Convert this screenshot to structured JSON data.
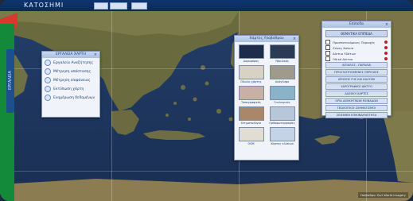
{
  "app": {
    "title": "ΚΑΤΟΣΗΜΙ"
  },
  "sidebar_tab": {
    "label": "ΕΡΓΑΛΕΙΑ"
  },
  "left_panel": {
    "title": "ΕΡΓΑΛΕΙΑ ΧΑΡΤΗ",
    "items": [
      {
        "label": "Εργαλεία Αναζήτησης",
        "icon": "search-icon"
      },
      {
        "label": "Μέτρηση απόστασης",
        "icon": "ruler-icon"
      },
      {
        "label": "Μέτρηση επιφάνειας",
        "icon": "area-icon"
      },
      {
        "label": "Εκτύπωση χάρτη",
        "icon": "print-icon"
      },
      {
        "label": "Ενημέρωση δεδομένων",
        "icon": "info-icon"
      }
    ]
  },
  "basemap_panel": {
    "title": "Χάρτες Υποβάθρου",
    "thumbs": [
      {
        "caption": "Δορυφόρος"
      },
      {
        "caption": "Υβριδικός"
      },
      {
        "caption": "Οδικός χάρτης"
      },
      {
        "caption": "Ανάγλυφο"
      },
      {
        "caption": "Τοπογραφικός"
      },
      {
        "caption": "Γεωλογικός"
      },
      {
        "caption": "Κτηματολόγιο"
      },
      {
        "caption": "Ορθοφωτογραφίες"
      },
      {
        "caption": "OSM"
      },
      {
        "caption": "Χάρτης κλίσεων"
      }
    ]
  },
  "right_panel": {
    "title": "Επίπεδα",
    "main_button": "ΘΕΜΑΤΙΚΑ ΕΠΙΠΕΔΑ",
    "rows": [
      "Προστατευόμενες Περιοχές",
      "Ζώνες Natura",
      "Δίκτυο Υδάτων",
      "Οδικό Δίκτυο"
    ],
    "buttons": [
      "ΑΙΓΙΑΛΟΣ - ΠΑΡΑΛΙΑ",
      "ΠΡΟΣΤΑΤΕΥΟΜΕΝΕΣ ΠΕΡΙΟΧΕΣ",
      "ΧΡΗΣΕΙΣ ΓΗΣ ΚΑΙ ΚΑΛΥΨΗ",
      "ΥΔΡΟΓΡΑΦΙΚΟ ΔΙΚΤΥΟ",
      "ΔΑΣΙΚΟΙ ΧΑΡΤΕΣ",
      "ΟΡΙΑ ΔΙΟΙΚΗΤΙΚΩΝ ΜΟΝΑΔΩΝ",
      "ΓΕΩΛΟΓΙΚΟΙ ΣΧΗΜΑΤΙΣΜΟΙ",
      "ΣΕΙΣΜΙΚΗ ΕΠΙΚΙΝΔΥΝΟΤΗΤΑ"
    ]
  },
  "footer": {
    "text": "Υπόβαθρο: Esri World Imagery"
  },
  "colors": {
    "topbar": "#0f3570",
    "flag_green": "#138a3a",
    "flag_red": "#d23b2e",
    "sea": "#1f3a66"
  }
}
